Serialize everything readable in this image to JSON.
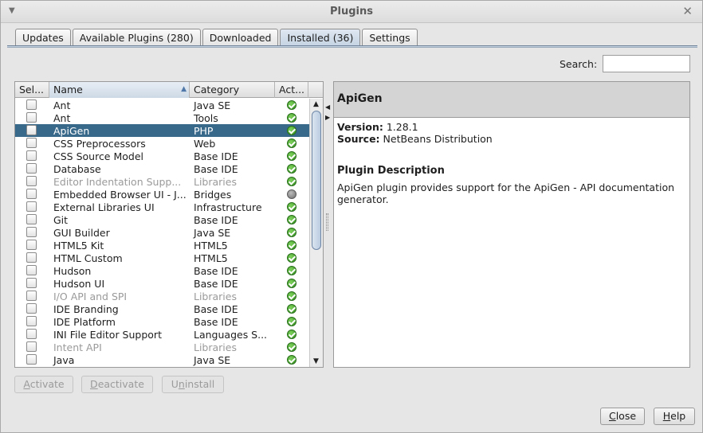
{
  "window": {
    "title": "Plugins"
  },
  "tabs": [
    {
      "label": "Updates",
      "active": false
    },
    {
      "label": "Available Plugins (280)",
      "active": false
    },
    {
      "label": "Downloaded",
      "active": false
    },
    {
      "label": "Installed (36)",
      "active": true
    },
    {
      "label": "Settings",
      "active": false
    }
  ],
  "search": {
    "label": "Search:",
    "value": ""
  },
  "table": {
    "columns": [
      "Sel...",
      "Name",
      "Category",
      "Act..."
    ],
    "rows": [
      {
        "name": "Ant",
        "category": "Java SE",
        "status": "ok",
        "selected": false,
        "disabled": false
      },
      {
        "name": "Ant",
        "category": "Tools",
        "status": "ok",
        "selected": false,
        "disabled": false
      },
      {
        "name": "ApiGen",
        "category": "PHP",
        "status": "ok",
        "selected": true,
        "disabled": false
      },
      {
        "name": "CSS Preprocessors",
        "category": "Web",
        "status": "ok",
        "selected": false,
        "disabled": false
      },
      {
        "name": "CSS Source Model",
        "category": "Base IDE",
        "status": "ok",
        "selected": false,
        "disabled": false
      },
      {
        "name": "Database",
        "category": "Base IDE",
        "status": "ok",
        "selected": false,
        "disabled": false
      },
      {
        "name": "Editor Indentation Supp...",
        "category": "Libraries",
        "status": "ok",
        "selected": false,
        "disabled": true
      },
      {
        "name": "Embedded Browser UI - J...",
        "category": "Bridges",
        "status": "off",
        "selected": false,
        "disabled": false
      },
      {
        "name": "External Libraries UI",
        "category": "Infrastructure",
        "status": "ok",
        "selected": false,
        "disabled": false
      },
      {
        "name": "Git",
        "category": "Base IDE",
        "status": "ok",
        "selected": false,
        "disabled": false
      },
      {
        "name": "GUI Builder",
        "category": "Java SE",
        "status": "ok",
        "selected": false,
        "disabled": false
      },
      {
        "name": "HTML5 Kit",
        "category": "HTML5",
        "status": "ok",
        "selected": false,
        "disabled": false
      },
      {
        "name": "HTML Custom",
        "category": "HTML5",
        "status": "ok",
        "selected": false,
        "disabled": false
      },
      {
        "name": "Hudson",
        "category": "Base IDE",
        "status": "ok",
        "selected": false,
        "disabled": false
      },
      {
        "name": "Hudson UI",
        "category": "Base IDE",
        "status": "ok",
        "selected": false,
        "disabled": false
      },
      {
        "name": "I/O API and SPI",
        "category": "Libraries",
        "status": "ok",
        "selected": false,
        "disabled": true
      },
      {
        "name": "IDE Branding",
        "category": "Base IDE",
        "status": "ok",
        "selected": false,
        "disabled": false
      },
      {
        "name": "IDE Platform",
        "category": "Base IDE",
        "status": "ok",
        "selected": false,
        "disabled": false
      },
      {
        "name": "INI File Editor Support",
        "category": "Languages S...",
        "status": "ok",
        "selected": false,
        "disabled": false
      },
      {
        "name": "Intent API",
        "category": "Libraries",
        "status": "ok",
        "selected": false,
        "disabled": true
      },
      {
        "name": "Java",
        "category": "Java SE",
        "status": "ok",
        "selected": false,
        "disabled": false
      }
    ]
  },
  "detail": {
    "title": "ApiGen",
    "version_label": "Version:",
    "version": "1.28.1",
    "source_label": "Source:",
    "source": "NetBeans Distribution",
    "desc_title": "Plugin Description",
    "desc_text": "ApiGen plugin provides support for the ApiGen - API documentation generator."
  },
  "buttons": {
    "activate": {
      "mn": "A",
      "rest": "ctivate"
    },
    "deactivate": {
      "mn": "D",
      "rest": "eactivate"
    },
    "uninstall_pre": "U",
    "uninstall_mn": "n",
    "uninstall_post": "install",
    "close": {
      "mn": "C",
      "rest": "lose"
    },
    "help": {
      "mn": "H",
      "rest": "elp"
    }
  },
  "colors": {
    "selection": "#39698a",
    "active_tab": "#c5d3e2"
  }
}
